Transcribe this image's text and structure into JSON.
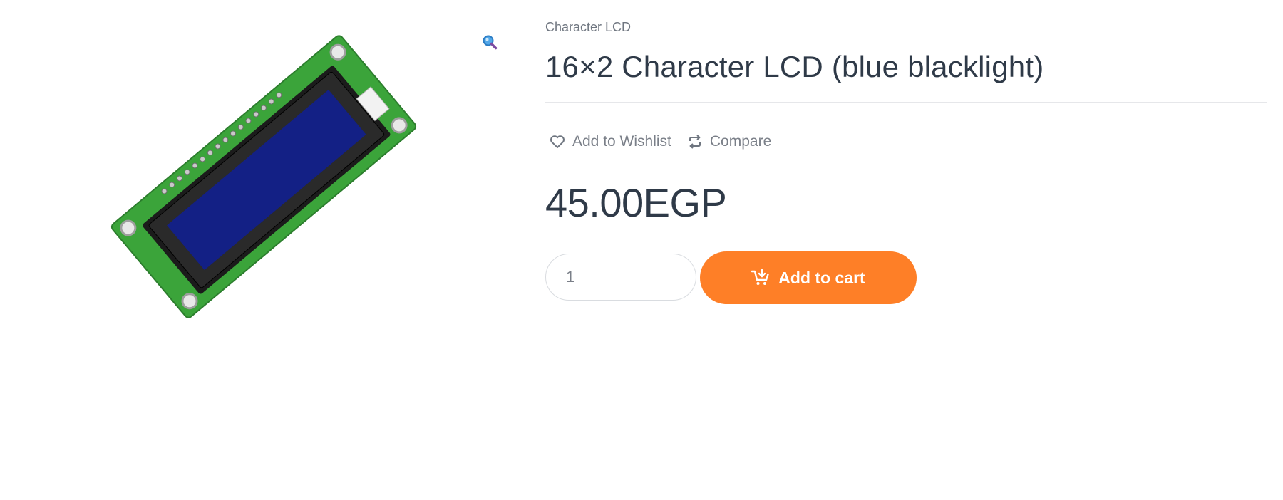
{
  "product": {
    "category": "Character LCD",
    "title": "16×2 Character LCD (blue blacklight)",
    "price": "45.00EGP",
    "image_alt": "16x2 Character LCD module",
    "colors": {
      "pcb_green": "#3ba43a",
      "lcd_blue": "#0f1a7a",
      "bezel_black": "#1b1b1b"
    }
  },
  "actions": {
    "wishlist_label": "Add to Wishlist",
    "compare_label": "Compare",
    "wishlist_icon": "heart-icon",
    "compare_icon": "compare-arrows-icon"
  },
  "cart": {
    "quantity": "1",
    "add_label": "Add to cart",
    "button_color": "#fe7f27",
    "icon": "cart-add-icon"
  },
  "gallery": {
    "zoom_icon": "magnifier-icon"
  }
}
